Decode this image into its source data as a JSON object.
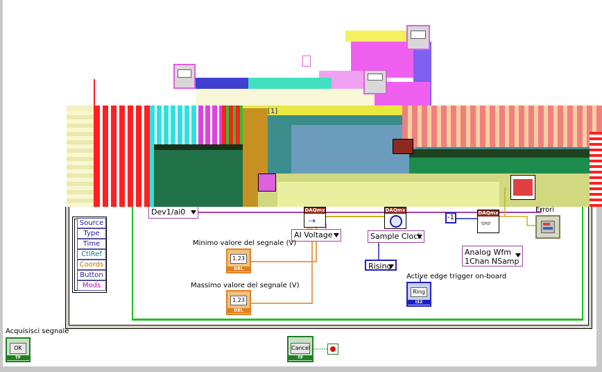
{
  "diagram": {
    "top_index_label": "[1]",
    "channel_constant": "Dev1/ai0",
    "task_type_combo": "AI Voltage",
    "timing_combo": "Sample Clock",
    "edge_combo": "Rising",
    "timeout_constant": "-1",
    "read_type_combo_line1": "Analog Wfm",
    "read_type_combo_line2": "1Chan NSamp",
    "errors_label": "Errori",
    "min_label": "Minimo valore del segnale (V)",
    "max_label": "Massimo valore del segnale (V)",
    "edge_trigger_label": "Active edge trigger on-board",
    "ring_text": "Ring",
    "num_text": "1.23",
    "dbl_tag": "DBL",
    "tf_tag": "TF",
    "i32_tag": "I32",
    "daq_tag": "DAQmx"
  },
  "event_fields": [
    "Source",
    "Type",
    "Time",
    "CtlRef",
    "Coords",
    "Button",
    "Mods"
  ],
  "event_field_colors": [
    "#1a1aa0",
    "#1a1aa0",
    "#1a1aa0",
    "#1a7a7a",
    "#c46a00",
    "#1a1aa0",
    "#c000c0"
  ],
  "bottom": {
    "acquire_label": "Acquisisci segnale",
    "ok_text": "OK",
    "cancel_text": "Cancel"
  },
  "colors": {
    "wire_orange": "#e08020",
    "wire_purple": "#a040a0",
    "wire_blue": "#2020c0",
    "loop_green": "#20c020",
    "frame_gray": "#c8c8c8",
    "daq_red": "#8c2a1e"
  }
}
